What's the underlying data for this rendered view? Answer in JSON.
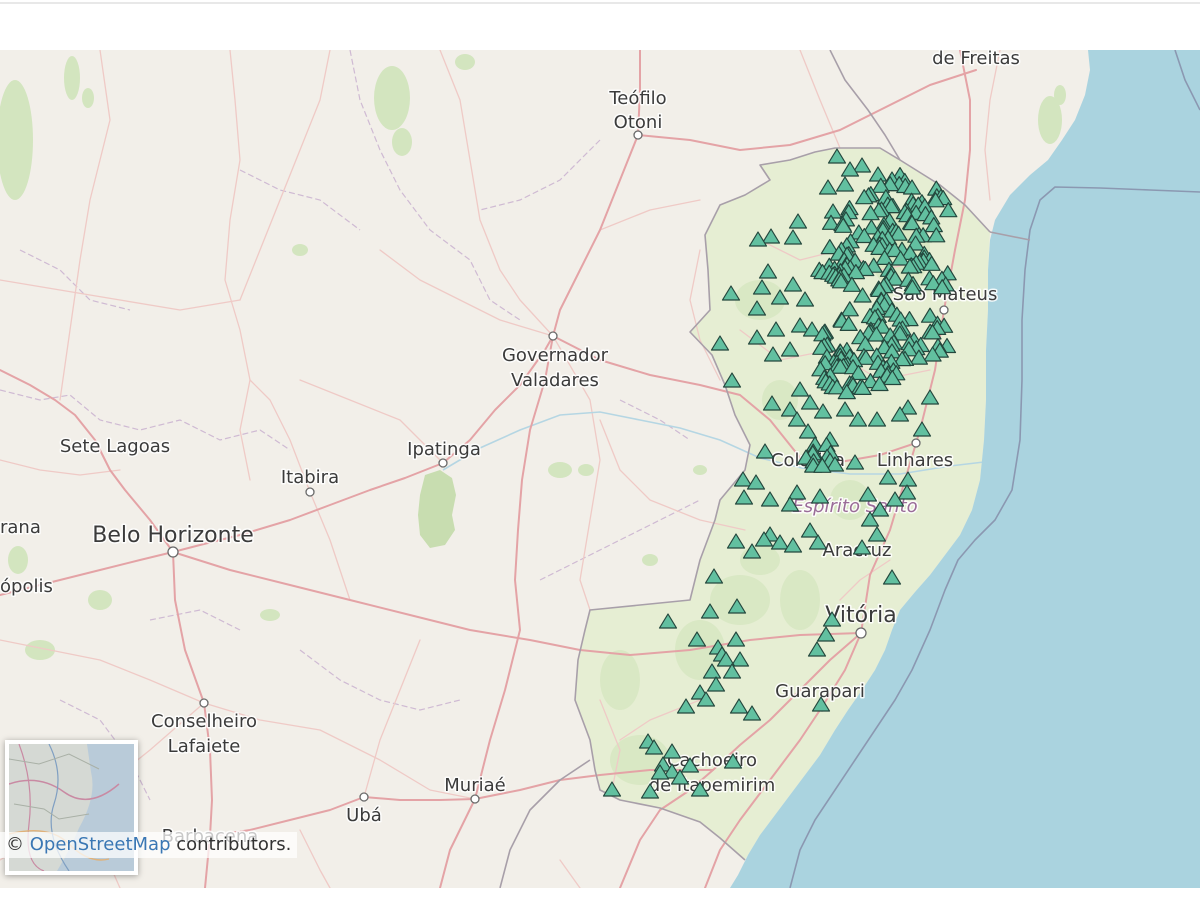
{
  "map": {
    "labels": {
      "de_freitas": "de Freitas",
      "teofilo_otoni_line1": "Teófilo",
      "teofilo_otoni_line2": "Otoni",
      "governador_valadares_line1": "Governador",
      "governador_valadares_line2": "Valadares",
      "sete_lagoas": "Sete Lagoas",
      "ipatinga": "Ipatinga",
      "itabira": "Itabira",
      "belo_horizonte": "Belo Horizonte",
      "rana": "rana",
      "opolis": "ópolis",
      "conselheiro_lafaiete_line1": "Conselheiro",
      "conselheiro_lafaiete_line2": "Lafaiete",
      "muriae": "Muriaé",
      "uba": "Ubá",
      "barbacena": "Barbacena",
      "sao_mateus": "São Mateus",
      "colatina": "Colatina",
      "linhares": "Linhares",
      "aracruz": "Aracruz",
      "vitoria": "Vitória",
      "guarapari": "Guarapari",
      "cachoeiro_line1": "Cachoeiro",
      "cachoeiro_line2": "de Itapemirim"
    },
    "state_label": "Espírito Santo",
    "marker_icon": "triangle-marker-icon",
    "colors": {
      "land": "#f2efe9",
      "ocean": "#aad3df",
      "highlighted_state": "#e6eed3",
      "marker_fill": "#62c0a0",
      "marker_stroke": "#24473d",
      "roads": "#e4a3a6",
      "state_label": "#9a6c98",
      "link": "#3a77b4"
    }
  },
  "layer_switcher": {
    "icon": "minimap-thumbnail-icon"
  },
  "attribution": {
    "prefix": "© ",
    "link": "OpenStreetMap",
    "suffix": " contributors."
  }
}
